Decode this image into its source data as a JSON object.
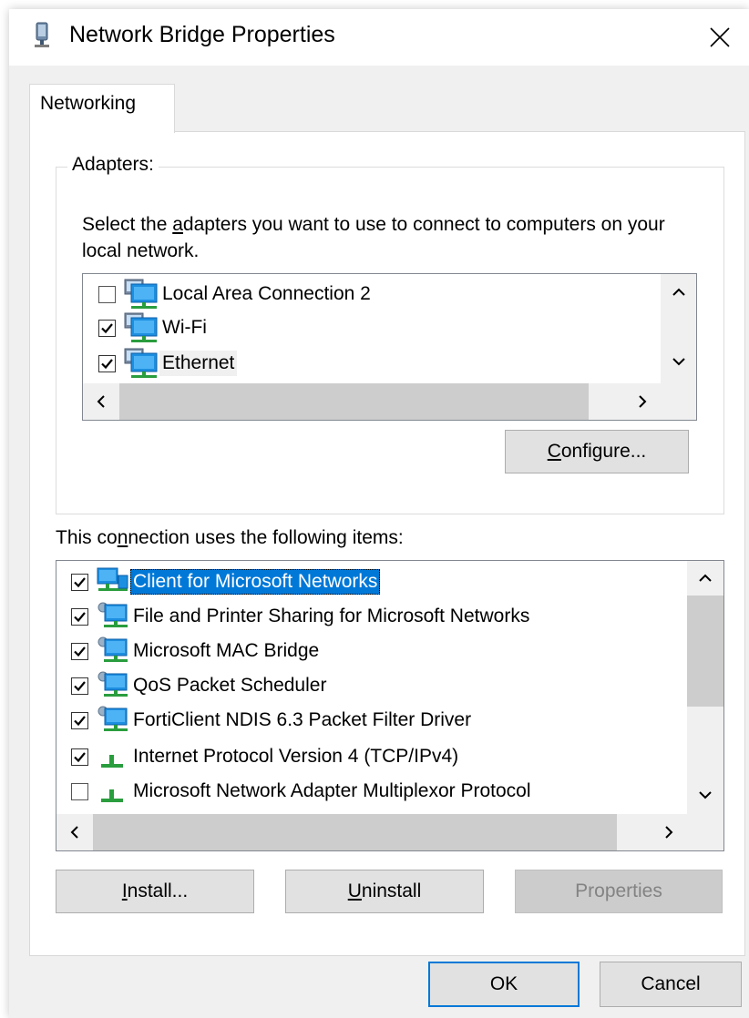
{
  "window": {
    "title": "Network Bridge Properties"
  },
  "tabs": [
    {
      "label": "Networking",
      "selected": true
    }
  ],
  "adapters": {
    "group_label": "Adapters:",
    "description_pre": "Select the ",
    "description_hotkey": "a",
    "description_post": "dapters you want to use to connect to computers on your local network.",
    "items": [
      {
        "label": "Local Area Connection 2",
        "checked": false,
        "icon": "network-adapter-icon"
      },
      {
        "label": "Wi-Fi",
        "checked": true,
        "icon": "network-adapter-icon"
      },
      {
        "label": "Ethernet",
        "checked": true,
        "icon": "network-adapter-icon"
      }
    ],
    "configure_hotkey": "C",
    "configure_rest": "onfigure..."
  },
  "items_section": {
    "label_pre": "This co",
    "label_hotkey": "n",
    "label_post": "nection uses the following items:",
    "items": [
      {
        "label": "Client for Microsoft Networks",
        "checked": true,
        "icon": "network-client-icon",
        "selected": true
      },
      {
        "label": "File and Printer Sharing for Microsoft Networks",
        "checked": true,
        "icon": "network-service-icon"
      },
      {
        "label": "Microsoft MAC Bridge",
        "checked": true,
        "icon": "network-service-icon"
      },
      {
        "label": "QoS Packet Scheduler",
        "checked": true,
        "icon": "network-service-icon"
      },
      {
        "label": "FortiClient NDIS 6.3 Packet Filter Driver",
        "checked": true,
        "icon": "network-service-icon"
      },
      {
        "label": "Internet Protocol Version 4 (TCP/IPv4)",
        "checked": true,
        "icon": "protocol-icon"
      },
      {
        "label": "Microsoft Network Adapter Multiplexor Protocol",
        "checked": false,
        "icon": "protocol-icon"
      }
    ]
  },
  "buttons": {
    "install_hotkey": "I",
    "install_rest": "nstall...",
    "uninstall_hotkey": "U",
    "uninstall_rest": "ninstall",
    "properties": "Properties",
    "ok": "OK",
    "cancel": "Cancel"
  },
  "colors": {
    "selection": "#0078d7",
    "dialog_bg": "#f0f0f0",
    "button_bg": "#e1e1e1",
    "disabled_text": "#838383"
  }
}
